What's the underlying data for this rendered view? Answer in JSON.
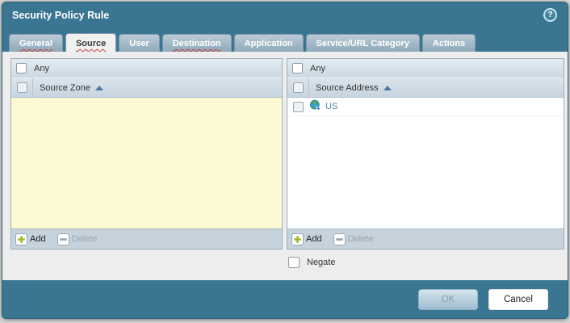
{
  "window": {
    "title": "Security Policy Rule",
    "help_glyph": "?"
  },
  "tabs": [
    {
      "label": "General",
      "active": false,
      "spellcheck_squiggle": true
    },
    {
      "label": "Source",
      "active": true,
      "spellcheck_squiggle": true
    },
    {
      "label": "User",
      "active": false,
      "spellcheck_squiggle": false
    },
    {
      "label": "Destination",
      "active": false,
      "spellcheck_squiggle": true
    },
    {
      "label": "Application",
      "active": false,
      "spellcheck_squiggle": false
    },
    {
      "label": "Service/URL Category",
      "active": false,
      "spellcheck_squiggle": false
    },
    {
      "label": "Actions",
      "active": false,
      "spellcheck_squiggle": false
    }
  ],
  "zone_panel": {
    "any_label": "Any",
    "any_checked": false,
    "header": "Source Zone",
    "sort": "ascending",
    "items": [],
    "add_label": "Add",
    "delete_label": "Delete",
    "delete_enabled": false
  },
  "address_panel": {
    "any_label": "Any",
    "any_checked": false,
    "header": "Source Address",
    "sort": "ascending",
    "items": [
      {
        "label": "US",
        "icon": "region-globe-icon",
        "checked": false
      }
    ],
    "add_label": "Add",
    "delete_label": "Delete",
    "delete_enabled": false
  },
  "negate": {
    "label": "Negate",
    "checked": false
  },
  "footer": {
    "ok_label": "OK",
    "ok_enabled": false,
    "cancel_label": "Cancel"
  },
  "colors": {
    "titlebar_teal": "#3A7591",
    "tab_inactive": "#9DB4C3",
    "active_tab_bg": "#F0F0F0",
    "panel_yellow": "#FCF9D3",
    "header_row_blue": "#CFDBE4",
    "bottom_bar_blue": "#C6D3DD",
    "squiggle_red": "#C43B3B",
    "item_link_blue": "#4D7EA8",
    "add_plus_green": "#A3B72A",
    "sort_arrow_blue": "#4A7AA5"
  }
}
